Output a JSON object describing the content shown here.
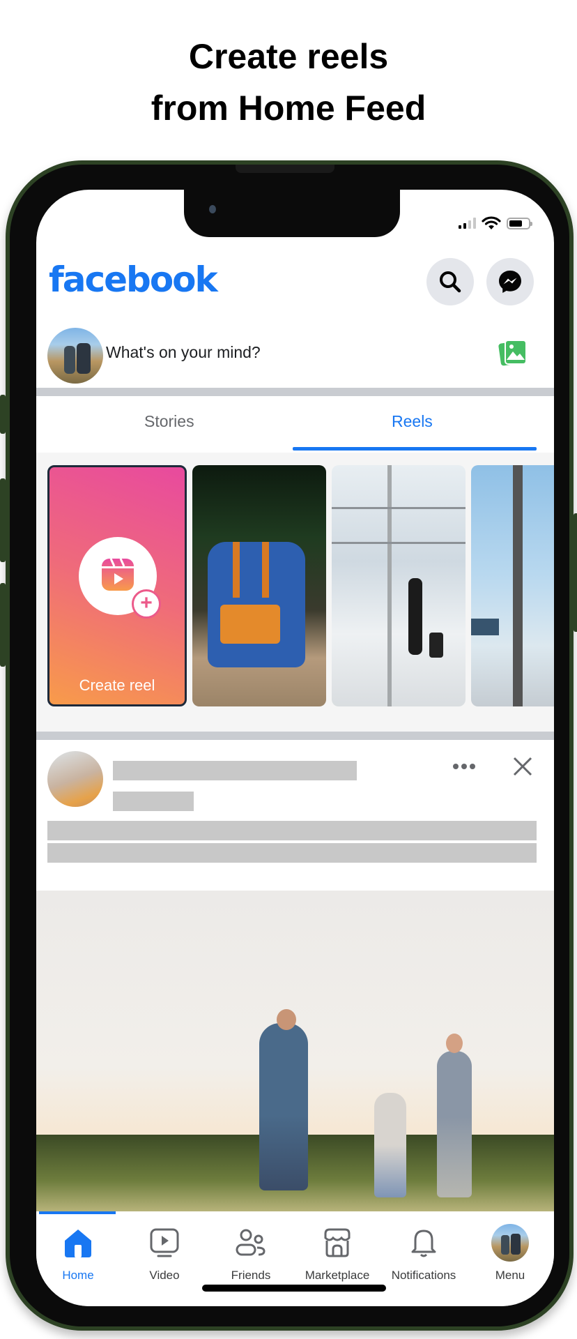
{
  "headline": {
    "line1": "Create reels",
    "line2": "from Home Feed"
  },
  "status_bar": {
    "signal_bars_on": 2,
    "signal_bars_total": 4,
    "wifi": "wifi-icon",
    "battery_level": 0.7
  },
  "header": {
    "logo": "facebook",
    "search_icon": "search-icon",
    "messenger_icon": "messenger-icon"
  },
  "composer": {
    "placeholder": "What's on your mind?",
    "photo_icon": "photo-icon"
  },
  "tabs": [
    {
      "label": "Stories",
      "active": false
    },
    {
      "label": "Reels",
      "active": true
    }
  ],
  "reels": {
    "create_label": "Create reel",
    "items": [
      {
        "description": "blue backpack on path"
      },
      {
        "description": "woman with suitcase at airport"
      },
      {
        "description": "airport lounge window"
      }
    ]
  },
  "post": {
    "more_icon": "more-icon",
    "close_icon": "close-icon",
    "image_description": "family walking in field at sunset"
  },
  "bottom_nav": [
    {
      "label": "Home",
      "icon": "home-icon",
      "active": true
    },
    {
      "label": "Video",
      "icon": "video-icon",
      "active": false
    },
    {
      "label": "Friends",
      "icon": "friends-icon",
      "active": false
    },
    {
      "label": "Marketplace",
      "icon": "marketplace-icon",
      "active": false
    },
    {
      "label": "Notifications",
      "icon": "bell-icon",
      "active": false
    },
    {
      "label": "Menu",
      "icon": "profile-avatar",
      "active": false
    }
  ],
  "colors": {
    "brand": "#1877f2",
    "divider": "#c9ccd1",
    "skeleton": "#c8c8c8",
    "phone_frame": "#2d4224",
    "photo_green": "#45bd62"
  }
}
